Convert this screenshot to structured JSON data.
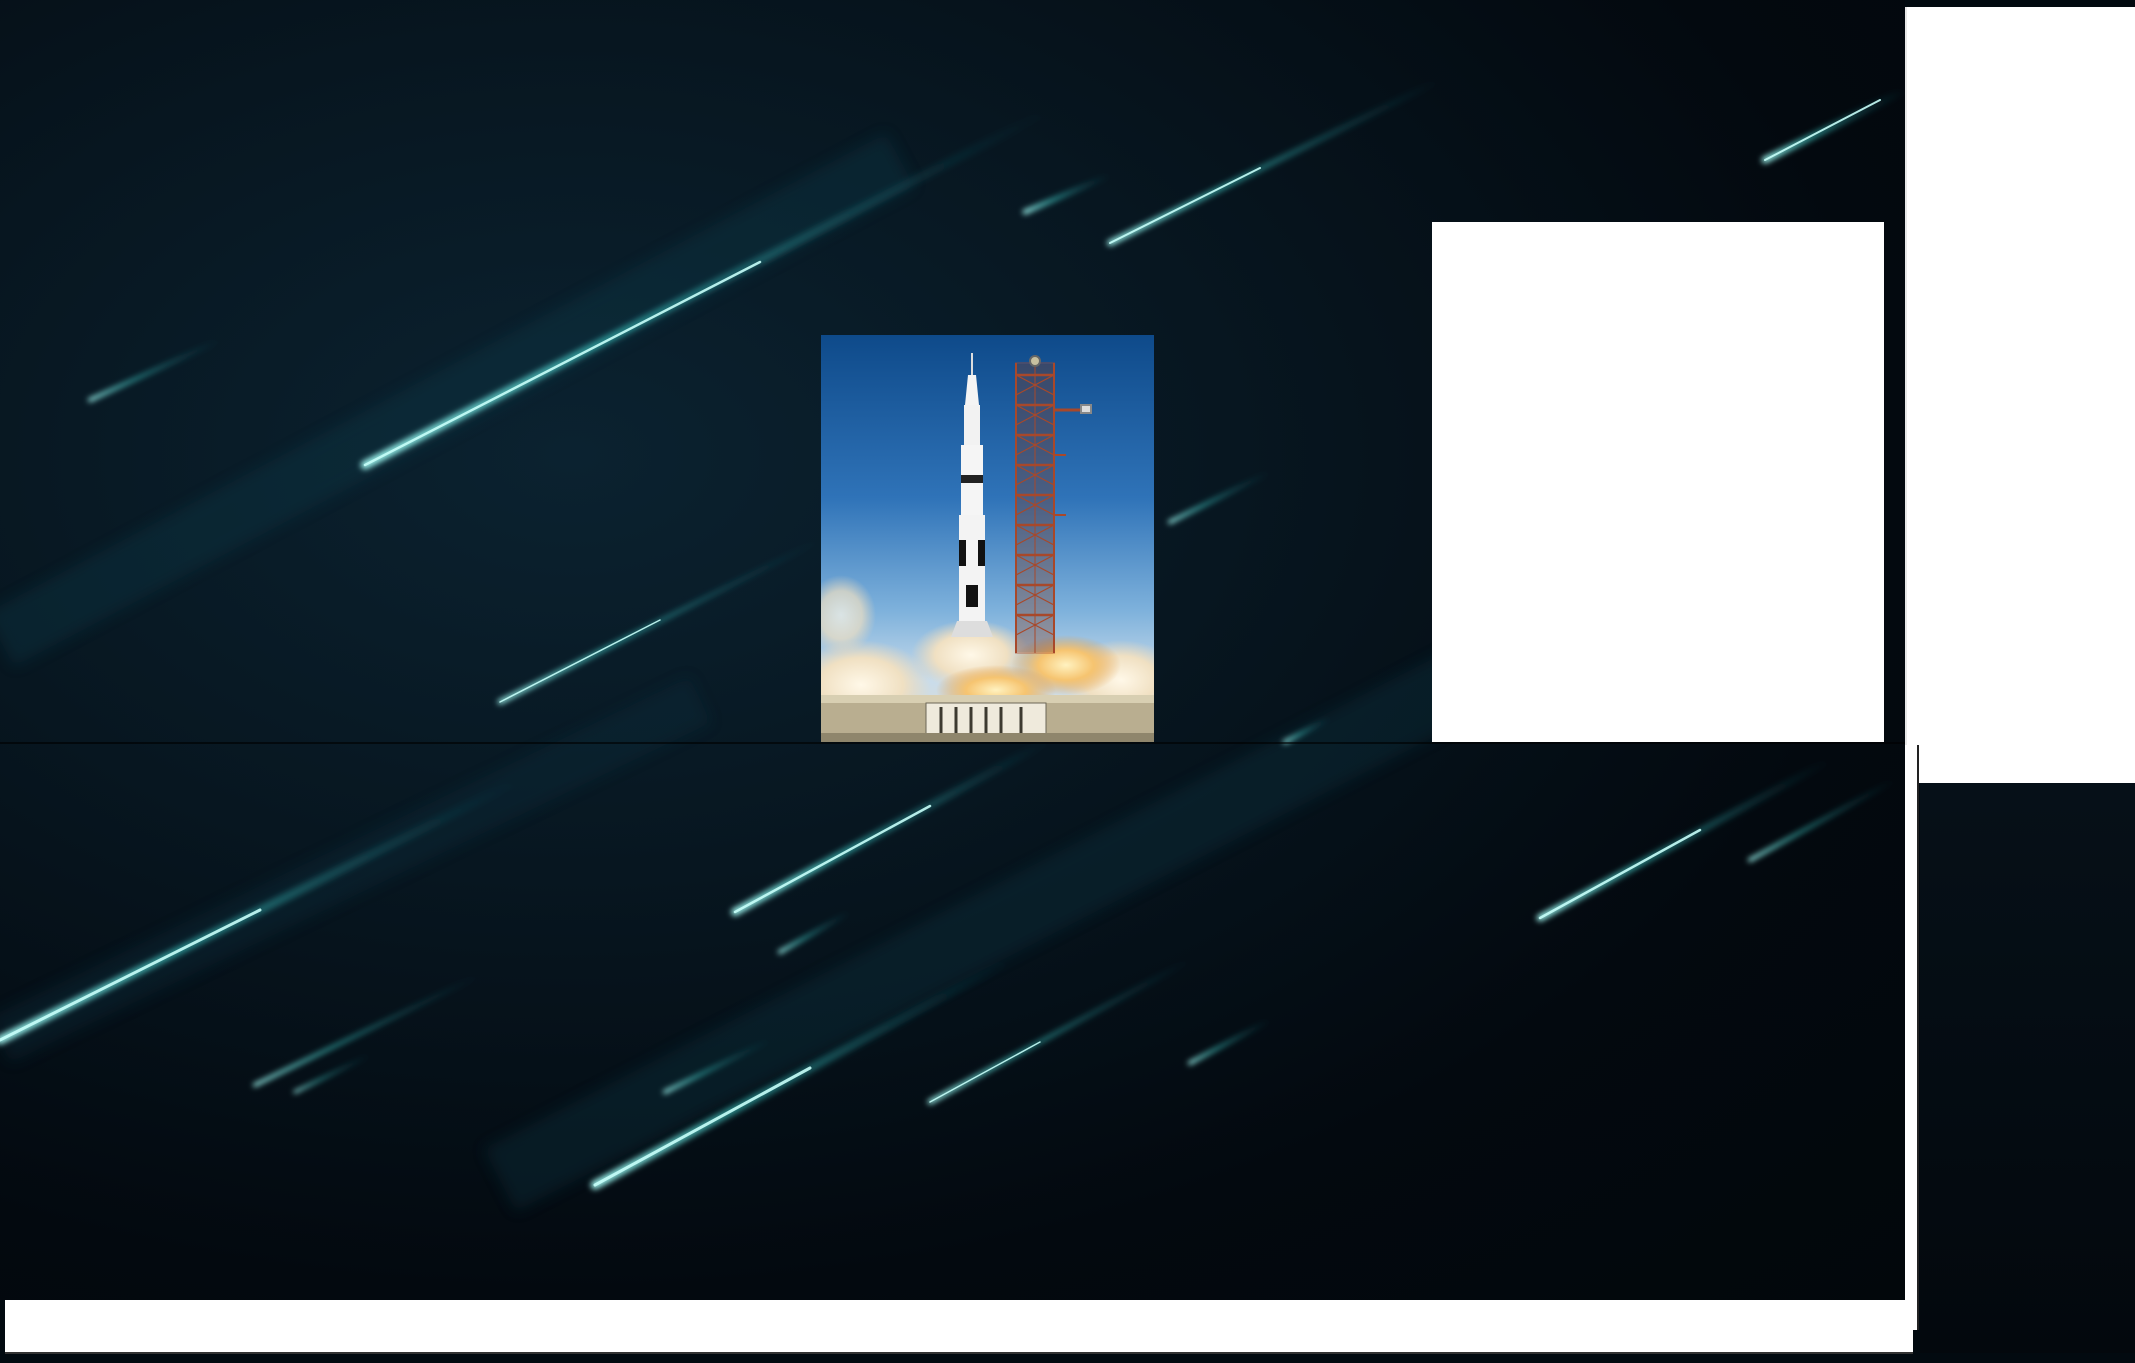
{
  "background": {
    "name": "space-streaks-background",
    "accent": "#3fd6d0",
    "base": "#03090f"
  },
  "image": {
    "subject": "rocket-launch-photo",
    "sky_top": "#0e4a8a",
    "sky_bottom": "#bfd6ea",
    "tower_color": "#a8482a",
    "rocket_color": "#f2f2f2"
  },
  "panels": {
    "color": "#ffffff"
  }
}
